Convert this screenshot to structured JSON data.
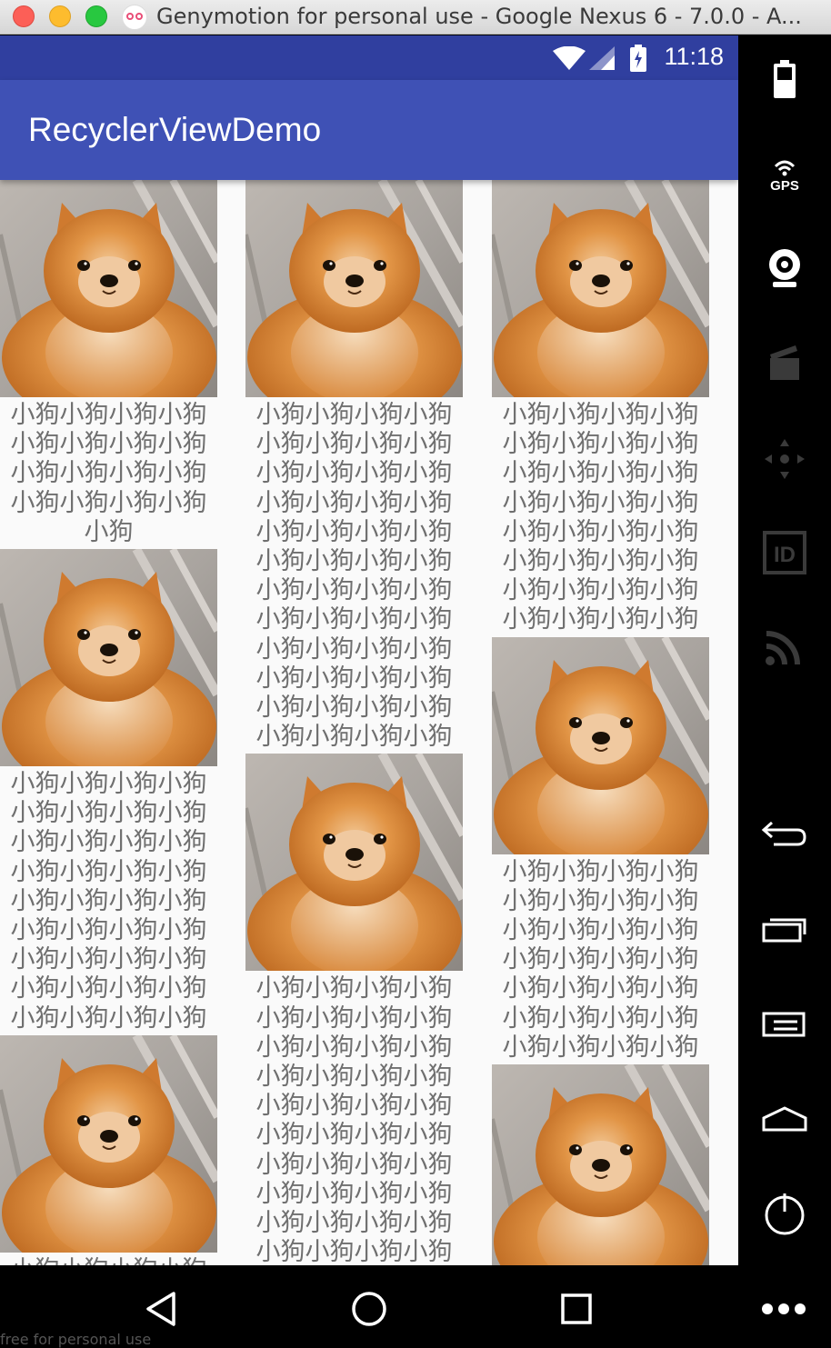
{
  "window": {
    "title": "Genymotion for personal use - Google Nexus 6 - 7.0.0 - A..."
  },
  "status_bar": {
    "time": "11:18",
    "icons": [
      "wifi-icon",
      "signal-icon",
      "battery-charging-icon"
    ]
  },
  "toolbar": {
    "title": "RecyclerViewDemo"
  },
  "columns": [
    {
      "cards": [
        {
          "caption": "小狗小狗小狗小狗小狗小狗小狗小狗小狗小狗小狗小狗小狗小狗小狗小狗小狗"
        },
        {
          "caption": "小狗小狗小狗小狗小狗小狗小狗小狗小狗小狗小狗小狗小狗小狗小狗小狗小狗小狗小狗小狗小狗小狗小狗小狗小狗小狗小狗小狗小狗小狗小狗小狗小狗小狗小狗小狗"
        },
        {
          "caption": "小狗小狗小狗小狗"
        }
      ]
    },
    {
      "cards": [
        {
          "caption": "小狗小狗小狗小狗小狗小狗小狗小狗小狗小狗小狗小狗小狗小狗小狗小狗小狗小狗小狗小狗小狗小狗小狗小狗小狗小狗小狗小狗小狗小狗小狗小狗小狗小狗小狗小狗小狗小狗小狗小狗小狗小狗小狗小狗小狗小狗小狗小狗"
        },
        {
          "caption": "小狗小狗小狗小狗小狗小狗小狗小狗小狗小狗小狗小狗小狗小狗小狗小狗小狗小狗小狗小狗小狗小狗小狗小狗小狗小狗小狗小狗小狗小狗小狗小狗小狗小狗小狗小狗小狗小狗小狗小狗"
        }
      ]
    },
    {
      "cards": [
        {
          "caption": "小狗小狗小狗小狗小狗小狗小狗小狗小狗小狗小狗小狗小狗小狗小狗小狗小狗小狗小狗小狗小狗小狗小狗小狗小狗小狗小狗小狗小狗小狗小狗小狗"
        },
        {
          "caption": "小狗小狗小狗小狗小狗小狗小狗小狗小狗小狗小狗小狗小狗小狗小狗小狗小狗小狗小狗小狗小狗小狗小狗小狗小狗小狗小狗小狗"
        },
        {
          "caption": ""
        }
      ]
    }
  ],
  "sidebar": {
    "buttons": [
      "battery-icon",
      "gps-icon",
      "webcam-icon",
      "screencast-icon",
      "dpad-icon",
      "device-id-icon",
      "remote-control-icon",
      "back-icon",
      "recent-apps-icon",
      "menu-icon",
      "home-icon",
      "power-icon"
    ],
    "gps_label": "GPS",
    "id_label": "ID"
  },
  "navbar": {
    "buttons": [
      "nav-back-icon",
      "nav-home-icon",
      "nav-recents-icon",
      "more-icon"
    ]
  },
  "watermark": "free for personal use"
}
